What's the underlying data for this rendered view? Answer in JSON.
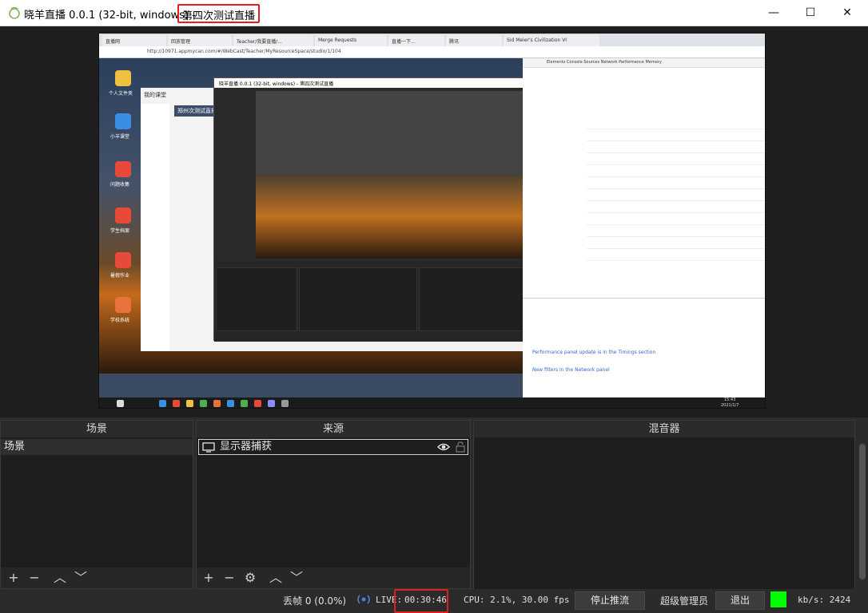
{
  "window": {
    "title": "晓羊直播 0.0.1 (32-bit, windows) -",
    "title_suffix": "第四次测试直播",
    "controls": {
      "minimize": "—",
      "maximize": "☐",
      "close": "✕"
    }
  },
  "preview": {
    "browser_tabs": [
      "直播网",
      "回放管理",
      "Teacher/我要直播/...",
      "Merge Requests",
      "直播一下...",
      "腾讯",
      "Sid Meier's Civilization VI"
    ],
    "browser_url": "http://10971.appmycan.com/#/WebCast/Teacher/MyResourceSpace/studio/1/104",
    "lms_header": "我的课堂",
    "lms_sub": "郑州次测试直播",
    "inner_obs_title": "晓羊直播 0.0.1 (32-bit, windows) - 第四次测试直播",
    "desktop_labels": [
      "个人文件夹",
      "小羊课堂",
      "问题收集",
      "学生档案",
      "暑假作业",
      "学校系统"
    ],
    "devtools_tabs": "Elements  Console  Sources  Network  Performance  Memory",
    "devtools_panel_links": [
      "Performance panel update is in the Timings section",
      "New filters in the Network panel"
    ],
    "taskbar_time": "15:43",
    "taskbar_date": "2021/1/7"
  },
  "docks": {
    "scenes": {
      "title": "场景",
      "items": [
        "场景"
      ]
    },
    "sources": {
      "title": "来源",
      "items": [
        "显示器捕获"
      ]
    },
    "mixer": {
      "title": "混音器"
    }
  },
  "controls": {
    "add": "+",
    "remove": "−",
    "up": "︿",
    "down": "﹀",
    "settings": "⚙"
  },
  "status": {
    "dropped_frames": "丢帧 0 (0.0%)",
    "live_label": "LIVE:",
    "live_time": "00:30:46",
    "cpu": "CPU: 2.1%, 30.00 fps",
    "stop_stream": "停止推流",
    "user": "超级管理员",
    "logout": "退出",
    "bitrate": "kb/s: 2424",
    "indicator_color": "#00ff00"
  }
}
